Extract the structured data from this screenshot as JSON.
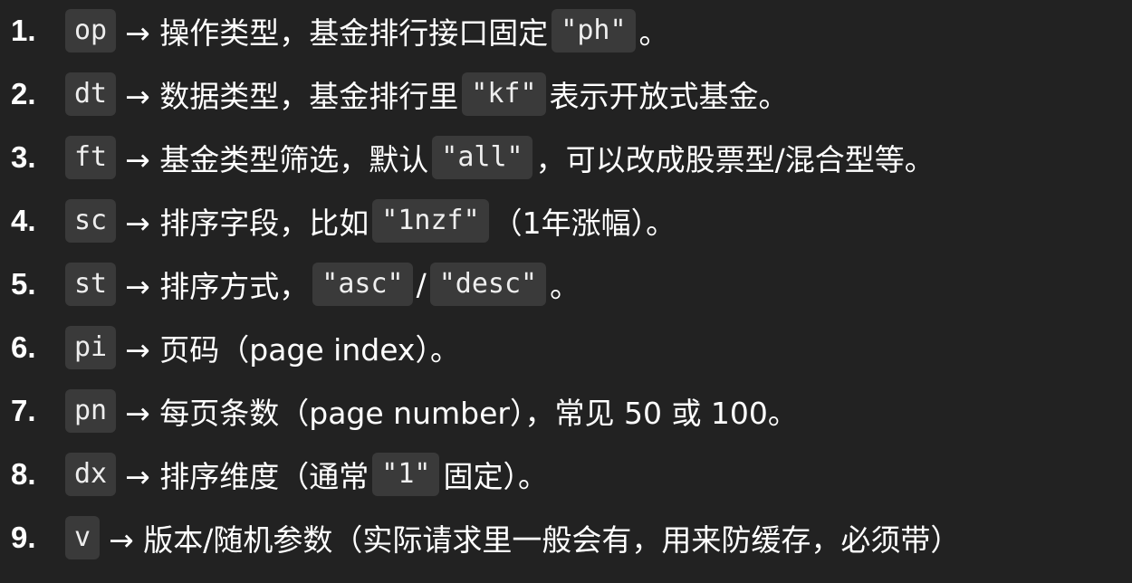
{
  "items": [
    {
      "num": "1.",
      "key": "op",
      "parts": [
        "→ 操作类型，基金排行接口固定 ",
        "\"ph\"",
        "。"
      ]
    },
    {
      "num": "2.",
      "key": "dt",
      "parts": [
        "→ 数据类型，基金排行里 ",
        "\"kf\"",
        " 表示开放式基金。"
      ]
    },
    {
      "num": "3.",
      "key": "ft",
      "parts": [
        "→ 基金类型筛选，默认 ",
        "\"all\"",
        "，可以改成股票型/混合型等。"
      ]
    },
    {
      "num": "4.",
      "key": "sc",
      "parts": [
        "→ 排序字段，比如 ",
        "\"1nzf\"",
        "（1年涨幅）。"
      ]
    },
    {
      "num": "5.",
      "key": "st",
      "parts": [
        "→ 排序方式，",
        "\"asc\"",
        " / ",
        "\"desc\"",
        "。"
      ]
    },
    {
      "num": "6.",
      "key": "pi",
      "parts": [
        "→ 页码（page index）。"
      ]
    },
    {
      "num": "7.",
      "key": "pn",
      "parts": [
        "→ 每页条数（page number），常见 50 或 100。"
      ]
    },
    {
      "num": "8.",
      "key": "dx",
      "parts": [
        "→ 排序维度（通常 ",
        "\"1\"",
        " 固定）。"
      ]
    },
    {
      "num": "9.",
      "key": "v",
      "parts": [
        "→ 版本/随机参数（实际请求里一般会有，用来防缓存，必须带）"
      ]
    }
  ]
}
